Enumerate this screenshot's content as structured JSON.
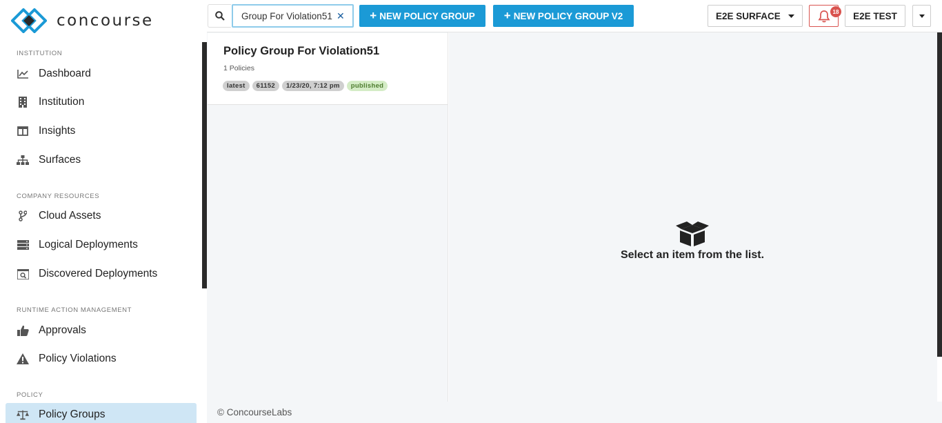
{
  "brand": {
    "name": "concourse",
    "accent": "#1b9ad6"
  },
  "sidebar": {
    "sections": [
      {
        "label": "INSTITUTION",
        "items": [
          {
            "label": "Dashboard",
            "icon": "chart-line-icon"
          },
          {
            "label": "Institution",
            "icon": "building-icon"
          },
          {
            "label": "Insights",
            "icon": "columns-icon"
          },
          {
            "label": "Surfaces",
            "icon": "sitemap-icon"
          }
        ]
      },
      {
        "label": "COMPANY RESOURCES",
        "items": [
          {
            "label": "Cloud Assets",
            "icon": "branch-icon"
          },
          {
            "label": "Logical Deployments",
            "icon": "server-icon"
          },
          {
            "label": "Discovered Deployments",
            "icon": "search-list-icon"
          }
        ]
      },
      {
        "label": "RUNTIME ACTION MANAGEMENT",
        "items": [
          {
            "label": "Approvals",
            "icon": "thumbs-up-icon"
          },
          {
            "label": "Policy Violations",
            "icon": "warning-icon"
          }
        ]
      },
      {
        "label": "POLICY",
        "items": [
          {
            "label": "Policy Groups",
            "icon": "balance-scale-icon",
            "active": true
          }
        ]
      }
    ]
  },
  "topbar": {
    "search_value": "Group For Violation51",
    "new_policy_group_label": "NEW POLICY GROUP",
    "new_policy_group_v2_label": "NEW POLICY GROUP V2",
    "surface_select": "E2E SURFACE",
    "notification_count": "18",
    "user_label": "E2E TEST"
  },
  "list": {
    "items": [
      {
        "title": "Policy Group For Violation51",
        "subtitle": "1 Policies",
        "tags": [
          "latest",
          "61152",
          "1/23/20, 7:12 pm",
          "published"
        ]
      }
    ]
  },
  "detail": {
    "empty_message": "Select an item from the list."
  },
  "footer": {
    "text": "© ConcourseLabs"
  }
}
